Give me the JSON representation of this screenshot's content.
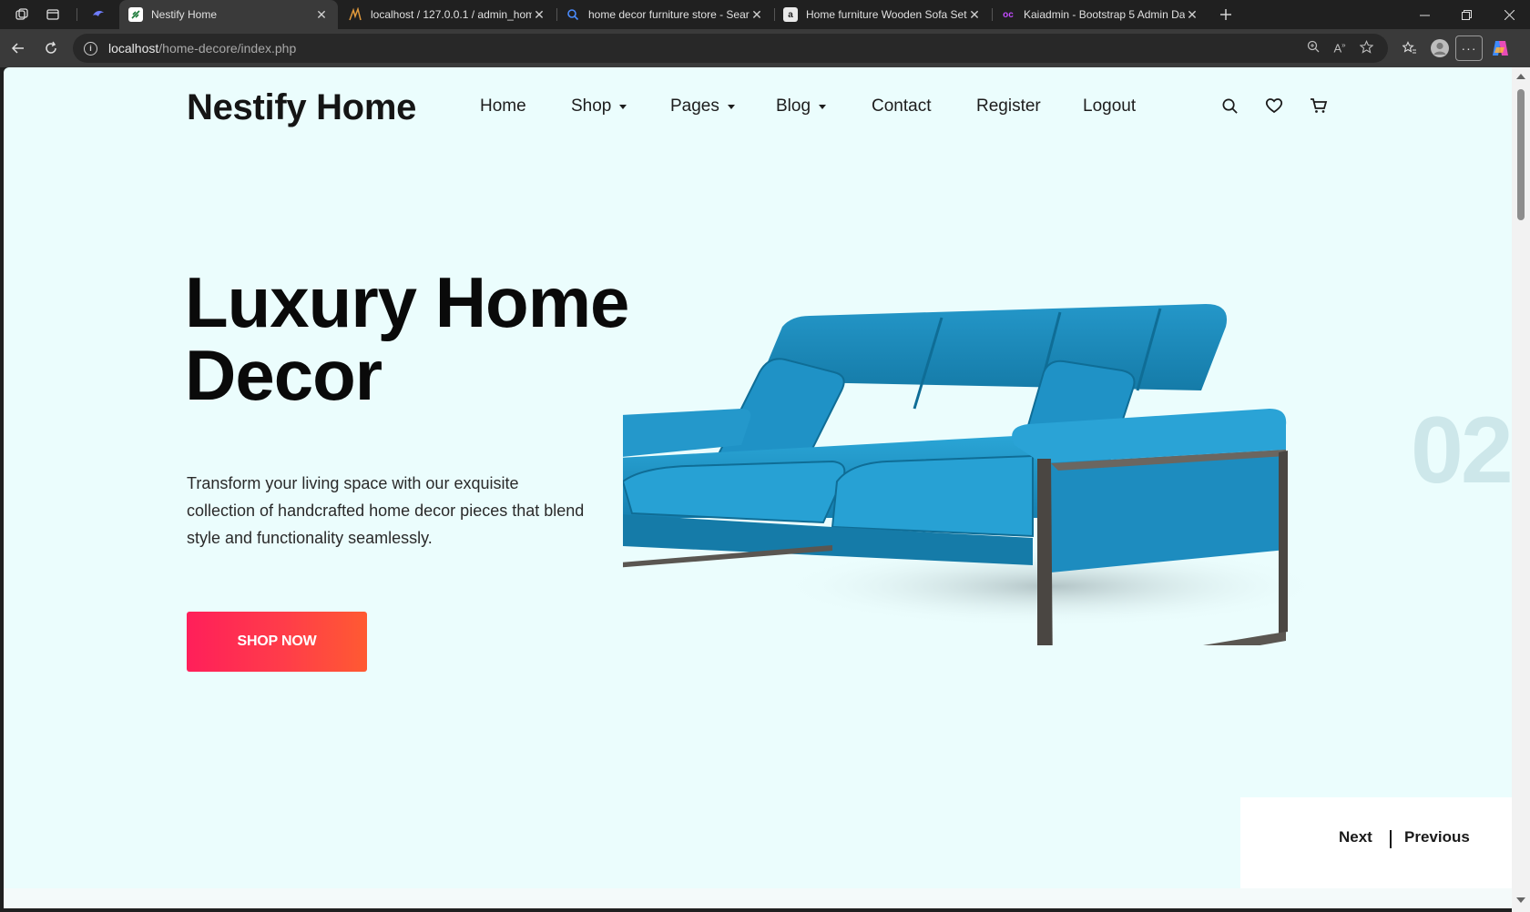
{
  "browser": {
    "tabs": [
      {
        "title": "",
        "favicon": "bird-icon"
      },
      {
        "title": "Nestify Home",
        "favicon": "leaf-icon",
        "active": true
      },
      {
        "title": "localhost / 127.0.0.1 / admin_hom",
        "favicon": "phpmyadmin-icon"
      },
      {
        "title": "home decor furniture store - Sear",
        "favicon": "search-icon"
      },
      {
        "title": "Home furniture Wooden Sofa Set",
        "favicon": "amazon-icon"
      },
      {
        "title": "Kaiadmin - Bootstrap 5 Admin Da",
        "favicon": "kaiadmin-icon"
      }
    ],
    "url_host": "localhost",
    "url_path": "/home-decore/index.php"
  },
  "site": {
    "brand": "Nestify Home",
    "nav": [
      {
        "label": "Home",
        "dropdown": false
      },
      {
        "label": "Shop",
        "dropdown": true
      },
      {
        "label": "Pages",
        "dropdown": true
      },
      {
        "label": "Blog",
        "dropdown": true
      },
      {
        "label": "Contact",
        "dropdown": false
      },
      {
        "label": "Register",
        "dropdown": false
      },
      {
        "label": "Logout",
        "dropdown": false
      }
    ],
    "header_icons": [
      "search-icon",
      "heart-icon",
      "cart-icon"
    ]
  },
  "hero": {
    "title_line1": "Luxury Home",
    "title_line2": "Decor",
    "text": "Transform your living space with our exquisite collection of handcrafted home decor pieces that blend style and functionality seamlessly.",
    "cta": "SHOP NOW",
    "slide_number": "02",
    "image": "blue-sofa"
  },
  "pager": {
    "next": "Next",
    "previous": "Previous"
  },
  "colors": {
    "page_bg": "#ebfdfd",
    "cta_start": "#ff1f5a",
    "cta_end": "#ff5a32",
    "sofa": "#1f93c4"
  }
}
